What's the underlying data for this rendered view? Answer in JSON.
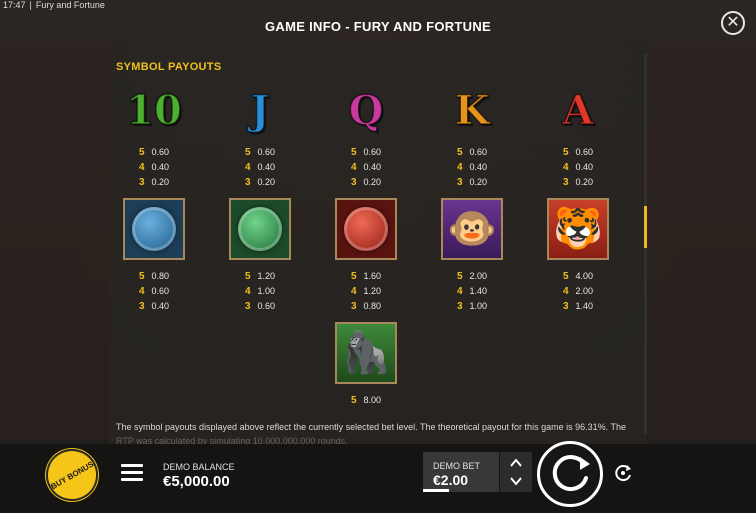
{
  "status": {
    "time": "17:47",
    "app_name": "Fury and Fortune"
  },
  "header": {
    "title": "GAME INFO - FURY AND FORTUNE",
    "close_icon": "close-icon"
  },
  "colors": {
    "accent": "#f0c020",
    "panel_bg": "#282522",
    "bonus": "#f5c518"
  },
  "section": {
    "title": "SYMBOL PAYOUTS"
  },
  "symbols": [
    {
      "name": "10",
      "icon": "ten-symbol",
      "color": "#4caf2f",
      "pays": [
        {
          "count": "5",
          "value": "0.60"
        },
        {
          "count": "4",
          "value": "0.40"
        },
        {
          "count": "3",
          "value": "0.20"
        }
      ]
    },
    {
      "name": "J",
      "icon": "j-symbol",
      "color": "#2a8fd8",
      "pays": [
        {
          "count": "5",
          "value": "0.60"
        },
        {
          "count": "4",
          "value": "0.40"
        },
        {
          "count": "3",
          "value": "0.20"
        }
      ]
    },
    {
      "name": "Q",
      "icon": "q-symbol",
      "color": "#c83a9e",
      "pays": [
        {
          "count": "5",
          "value": "0.60"
        },
        {
          "count": "4",
          "value": "0.40"
        },
        {
          "count": "3",
          "value": "0.20"
        }
      ]
    },
    {
      "name": "K",
      "icon": "k-symbol",
      "color": "#e8941c",
      "pays": [
        {
          "count": "5",
          "value": "0.60"
        },
        {
          "count": "4",
          "value": "0.40"
        },
        {
          "count": "3",
          "value": "0.20"
        }
      ]
    },
    {
      "name": "A",
      "icon": "a-symbol",
      "color": "#e0392b",
      "pays": [
        {
          "count": "5",
          "value": "0.60"
        },
        {
          "count": "4",
          "value": "0.40"
        },
        {
          "count": "3",
          "value": "0.20"
        }
      ]
    },
    {
      "name": "blue-monkey-coin",
      "icon": "blue-monkey-coin-icon",
      "color": "#2d6f9e",
      "pays": [
        {
          "count": "5",
          "value": "0.80"
        },
        {
          "count": "4",
          "value": "0.60"
        },
        {
          "count": "3",
          "value": "0.40"
        }
      ]
    },
    {
      "name": "green-tiger-coin",
      "icon": "green-tiger-coin-icon",
      "color": "#2f7a3e",
      "pays": [
        {
          "count": "5",
          "value": "1.20"
        },
        {
          "count": "4",
          "value": "1.00"
        },
        {
          "count": "3",
          "value": "0.60"
        }
      ]
    },
    {
      "name": "red-panda-coin",
      "icon": "red-panda-coin-icon",
      "color": "#b8281e",
      "pays": [
        {
          "count": "5",
          "value": "1.60"
        },
        {
          "count": "4",
          "value": "1.20"
        },
        {
          "count": "3",
          "value": "0.80"
        }
      ]
    },
    {
      "name": "monkey",
      "icon": "monkey-icon",
      "color": "#5a2a7e",
      "pays": [
        {
          "count": "5",
          "value": "2.00"
        },
        {
          "count": "4",
          "value": "1.40"
        },
        {
          "count": "3",
          "value": "1.00"
        }
      ]
    },
    {
      "name": "tiger",
      "icon": "tiger-icon",
      "color": "#b02a1e",
      "pays": [
        {
          "count": "5",
          "value": "4.00"
        },
        {
          "count": "4",
          "value": "2.00"
        },
        {
          "count": "3",
          "value": "1.40"
        }
      ]
    },
    {
      "name": "gorilla",
      "icon": "gorilla-icon",
      "color": "#2e6a2a",
      "pays": [
        {
          "count": "5",
          "value": "8.00"
        }
      ]
    }
  ],
  "disclaimer": {
    "line1": "The symbol payouts displayed above reflect the currently selected bet level. The theoretical payout for this game is 96.31%. The",
    "line2": "RTP was calculated by simulating 10,000,000,000 rounds."
  },
  "footer": {
    "buy_bonus_label": "BUY BONUS",
    "menu_icon": "hamburger-menu-icon",
    "balance_label": "DEMO BALANCE",
    "balance_value": "€5,000.00",
    "bet_label": "DEMO BET",
    "bet_value": "€2.00",
    "spin_icon": "spin-icon",
    "autoplay_icon": "autoplay-icon"
  }
}
